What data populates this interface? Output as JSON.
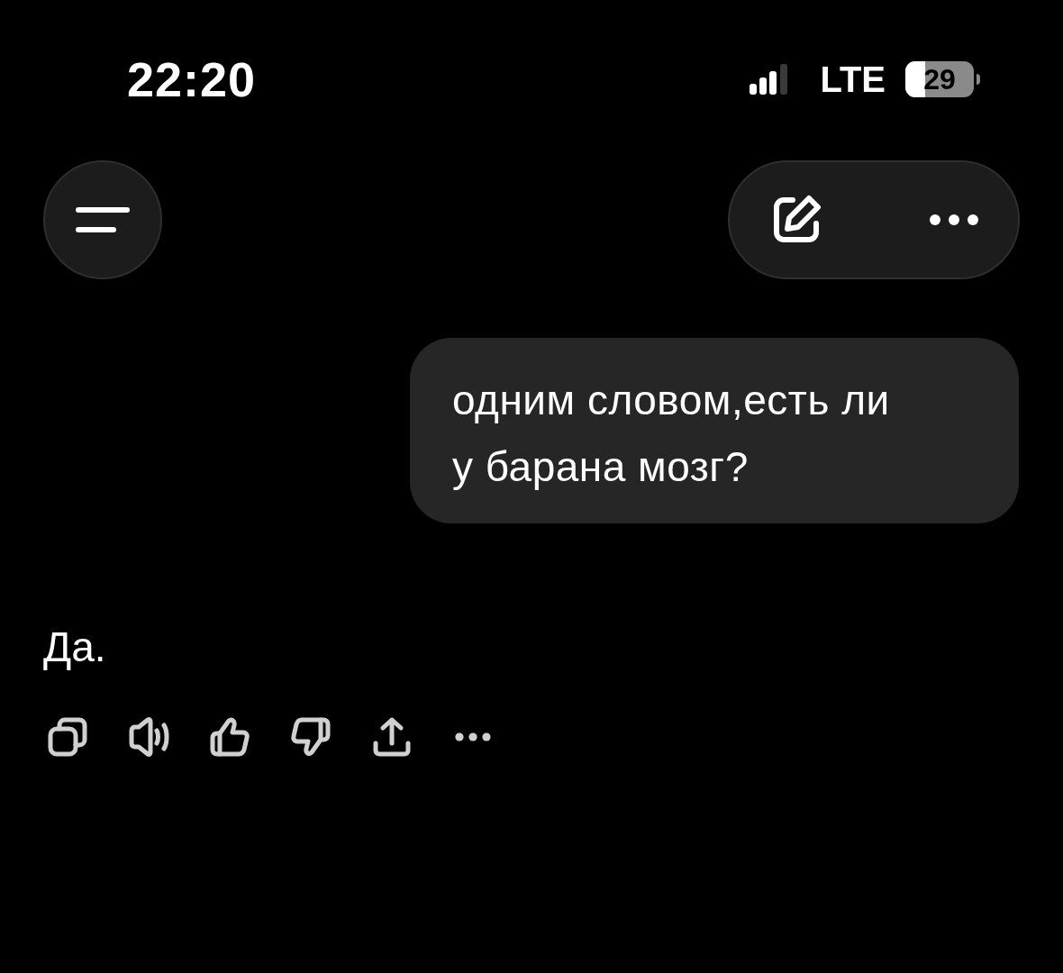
{
  "status_bar": {
    "time": "22:20",
    "network": "LTE",
    "battery": "29"
  },
  "messages": [
    {
      "kind": "user",
      "text": "одним словом,есть ли у барана мозг?"
    },
    {
      "kind": "assistant",
      "text": "Да."
    }
  ]
}
